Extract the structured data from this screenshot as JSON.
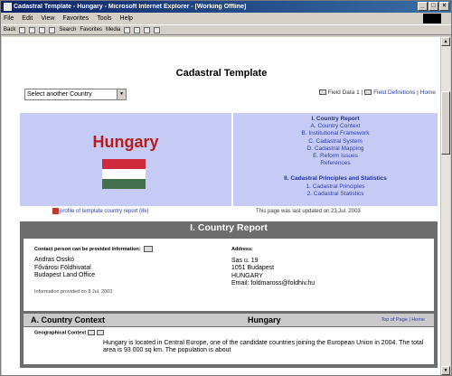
{
  "window": {
    "title": "Cadastral Template - Hungary - Microsoft Internet Explorer - [Working Offline]",
    "controls": [
      "_",
      "□",
      "×"
    ]
  },
  "menu": [
    "File",
    "Edit",
    "View",
    "Favorites",
    "Tools",
    "Help"
  ],
  "toolbar": {
    "back": "Back",
    "search": "Search",
    "favorites": "Favorites",
    "media": "Media"
  },
  "page": {
    "title": "Cadastral Template",
    "select_value": "Select another Country",
    "links": {
      "data1": "Field Data 1",
      "definitions": "Field Definitions",
      "home": "Home",
      "sep": "|"
    },
    "country": "Hungary",
    "flag_colors": [
      "#cd2a3e",
      "#ffffff",
      "#436f4d"
    ],
    "toc": {
      "section1": "I. Country Report",
      "items1": [
        "A. Country Context",
        "B. Institutional Framework",
        "C. Cadastral System",
        "D. Cadastral Mapping",
        "E. Reform Issues",
        "References"
      ],
      "section2": "II. Cadastral Principles and Statistics",
      "items2": [
        "1. Cadastral Principles",
        "2. Cadastral Statistics"
      ]
    },
    "pdf_link": "profile of template country report (8k)",
    "updated": "This page was last updated on 23 Jul. 2003"
  },
  "report": {
    "header": "I. Country Report",
    "contact_heading": "Contact person can be provided information:",
    "contact_lines": [
      "Andras Osskó",
      "Fővárosi Földhivatal",
      "Budapest Land Office"
    ],
    "info_date": "Information provided on 8 Jul. 2003",
    "address_heading": "Address:",
    "address_lines": [
      "Sas u. 19",
      "1051 Budapest",
      "HUNGARY",
      "Email: foldmaross@foldhiv.hu"
    ],
    "context_title": "A. Country Context",
    "context_country": "Hungary",
    "nav": "Top of Page | Home",
    "geo_label": "Geographical Context",
    "geo_text": "Hungary is located in Central Europe, one of the candidate countries joining the European Union in 2004. The total area is 93 000 sq km. The population is about"
  }
}
